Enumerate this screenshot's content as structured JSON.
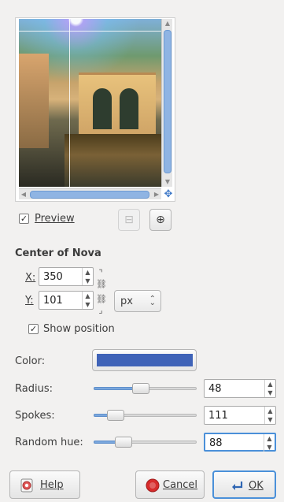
{
  "preview": {
    "label": "Preview",
    "checked": true,
    "zoom_out_icon": "zoom-out-icon",
    "zoom_in_icon": "zoom-in-icon",
    "navigate_icon": "navigate-icon"
  },
  "center": {
    "heading": "Center of Nova",
    "x_label": "X:",
    "x_value": "350",
    "y_label": "Y:",
    "y_value": "101",
    "unit": "px",
    "chain_icon": "chain-link-icon"
  },
  "show_position": {
    "label": "Show position",
    "checked": true
  },
  "color": {
    "label": "Color:",
    "value": "#3f63b8"
  },
  "radius": {
    "label": "Radius:",
    "value": "48",
    "level": 0.45
  },
  "spokes": {
    "label": "Spokes:",
    "value": "111",
    "level": 0.16
  },
  "random_hue": {
    "label": "Random hue:",
    "value": "88",
    "level": 0.25
  },
  "buttons": {
    "help": "Help",
    "cancel": "Cancel",
    "ok": "OK"
  }
}
